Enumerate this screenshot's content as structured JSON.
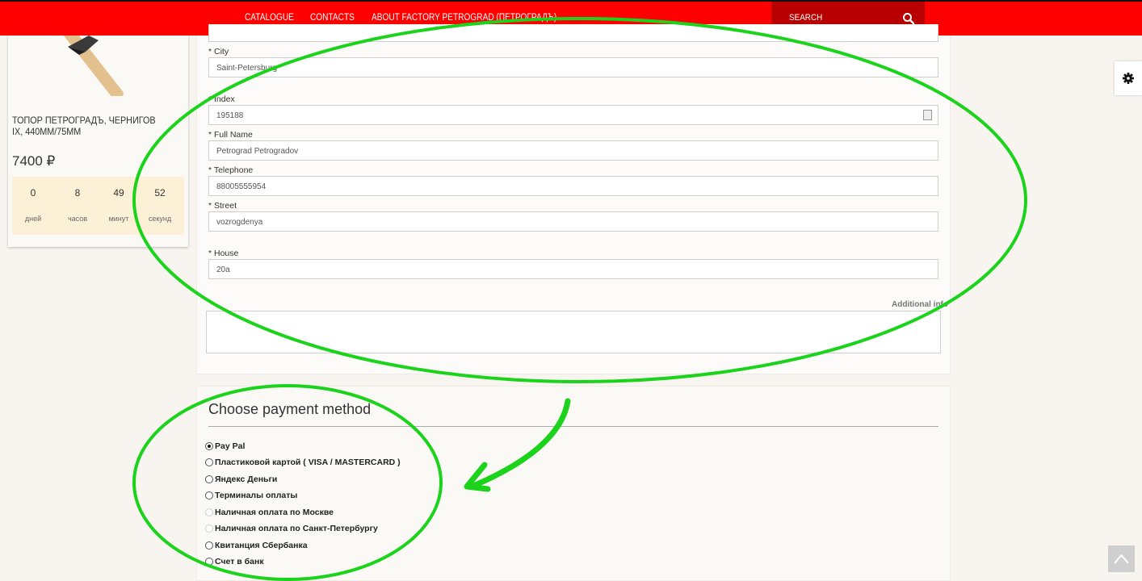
{
  "nav": {
    "items": [
      "CATALOGUE",
      "CONTACTS",
      "ABOUT FACTORY PETROGRAD (ПЕТРОГРАДЪ)"
    ],
    "search_label": "SEARCH"
  },
  "product": {
    "title": "ТОПОР ПЕТРОГРАДЪ, ЧЕРНИГОВ IX, 440ММ/75ММ",
    "price": "7400 ₽",
    "timer": [
      {
        "value": "0",
        "label": "дней"
      },
      {
        "value": "8",
        "label": "часов"
      },
      {
        "value": "49",
        "label": "минут"
      },
      {
        "value": "52",
        "label": "секунд"
      }
    ]
  },
  "form": {
    "city": {
      "label": "* City",
      "value": "Saint-Petersburg"
    },
    "index": {
      "label": "* Index",
      "value": "195188"
    },
    "full_name": {
      "label": "* Full Name",
      "value": "Petrograd Petrogradov"
    },
    "telephone": {
      "label": "* Telephone",
      "value": "88005555954"
    },
    "street": {
      "label": "* Street",
      "value": "vozrogdenya"
    },
    "house": {
      "label": "* House",
      "value": "20a"
    },
    "additional_info_label": "Additional info"
  },
  "payment": {
    "title": "Choose payment method",
    "options": [
      {
        "label": "Pay Pal",
        "selected": true,
        "enabled": true
      },
      {
        "label": "Пластиковой картой ( VISA / MASTERCARD )",
        "selected": false,
        "enabled": true
      },
      {
        "label": "Яндекс Деньги",
        "selected": false,
        "enabled": true
      },
      {
        "label": "Терминалы оплаты",
        "selected": false,
        "enabled": true
      },
      {
        "label": "Наличная оплата по Москве",
        "selected": false,
        "enabled": false
      },
      {
        "label": "Наличная оплата по Санкт-Петербургу",
        "selected": false,
        "enabled": false
      },
      {
        "label": "Квитанция Сбербанка",
        "selected": false,
        "enabled": true
      },
      {
        "label": "Счет в банк",
        "selected": false,
        "enabled": true
      }
    ]
  },
  "colors": {
    "nav_bg": "#fe0000",
    "search_bg": "#b80000",
    "annotation": "#1bd31b"
  },
  "icons": {
    "search": "search-icon",
    "settings": "gear-icon",
    "scroll_top": "chevron-up-icon"
  }
}
